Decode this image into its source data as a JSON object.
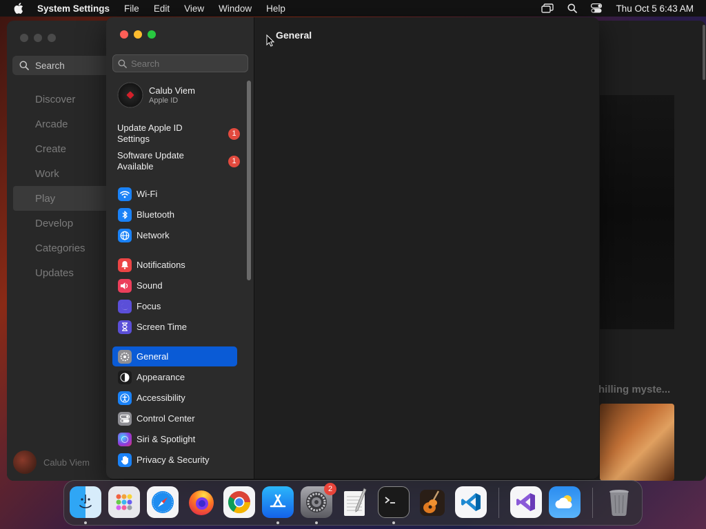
{
  "menubar": {
    "app_name": "System Settings",
    "menus": [
      "File",
      "Edit",
      "View",
      "Window",
      "Help"
    ],
    "clock": "Thu Oct 5  6:43 AM"
  },
  "background_app": {
    "search_label": "Search",
    "nav": [
      "Discover",
      "Arcade",
      "Create",
      "Work",
      "Play",
      "Develop",
      "Categories",
      "Updates"
    ],
    "active_nav": "Play",
    "user_name": "Calub Viem",
    "caption": "hilling myste..."
  },
  "settings": {
    "search_placeholder": "Search",
    "title": "General",
    "account": {
      "name": "Calub Viem",
      "subtitle": "Apple ID"
    },
    "notices": [
      {
        "label": "Update Apple ID Settings",
        "badge": "1"
      },
      {
        "label": "Software Update Available",
        "badge": "1"
      }
    ],
    "items": [
      {
        "label": "Wi-Fi",
        "icon": "wifi-icon",
        "color": "#1a82f7"
      },
      {
        "label": "Bluetooth",
        "icon": "bluetooth-icon",
        "color": "#1a82f7"
      },
      {
        "label": "Network",
        "icon": "globe-icon",
        "color": "#1a82f7"
      },
      {
        "label": "Notifications",
        "icon": "bell-icon",
        "color": "#ec4545"
      },
      {
        "label": "Sound",
        "icon": "speaker-icon",
        "color": "#ec3f5b"
      },
      {
        "label": "Focus",
        "icon": "moon-icon",
        "color": "#5b4fd8"
      },
      {
        "label": "Screen Time",
        "icon": "hourglass-icon",
        "color": "#5b4fd8"
      },
      {
        "label": "General",
        "icon": "gear-icon",
        "color": "#8e8e93"
      },
      {
        "label": "Appearance",
        "icon": "appearance-icon",
        "color": "#1c1c1c"
      },
      {
        "label": "Accessibility",
        "icon": "accessibility-icon",
        "color": "#1a82f7"
      },
      {
        "label": "Control Center",
        "icon": "control-center-icon",
        "color": "#8e8e93"
      },
      {
        "label": "Siri & Spotlight",
        "icon": "siri-icon",
        "color": "#8a3ce0"
      },
      {
        "label": "Privacy & Security",
        "icon": "hand-icon",
        "color": "#1a82f7"
      }
    ],
    "selected_item": "General"
  },
  "dock": {
    "apps": [
      {
        "name": "Finder",
        "icon": "finder-icon",
        "running": true
      },
      {
        "name": "Launchpad",
        "icon": "launchpad-icon",
        "running": false
      },
      {
        "name": "Safari",
        "icon": "safari-icon",
        "running": false
      },
      {
        "name": "Firefox",
        "icon": "firefox-icon",
        "running": false
      },
      {
        "name": "Chrome",
        "icon": "chrome-icon",
        "running": false
      },
      {
        "name": "App Store",
        "icon": "app-store-icon",
        "running": true
      },
      {
        "name": "System Settings",
        "icon": "system-settings-icon",
        "running": true,
        "badge": "2"
      },
      {
        "name": "TextEdit",
        "icon": "textedit-icon",
        "running": false
      },
      {
        "name": "Terminal",
        "icon": "terminal-icon",
        "running": true
      },
      {
        "name": "GarageBand",
        "icon": "garageband-icon",
        "running": false
      },
      {
        "name": "Visual Studio Code",
        "icon": "vscode-icon",
        "running": false
      },
      {
        "name": "Visual Studio",
        "icon": "visual-studio-icon",
        "running": false
      },
      {
        "name": "Weather",
        "icon": "weather-icon",
        "running": false
      },
      {
        "name": "Trash",
        "icon": "trash-icon",
        "running": false
      }
    ]
  }
}
